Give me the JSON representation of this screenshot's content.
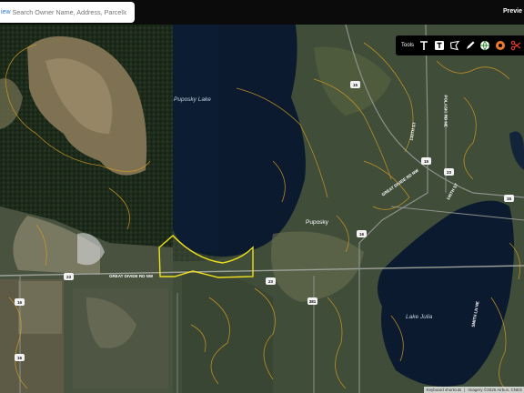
{
  "search": {
    "view_label": "iew",
    "placeholder": "Search Owner Name, Address, ParcelId"
  },
  "header": {
    "preview_label": "Previe"
  },
  "tools": {
    "label": "Tools",
    "items": [
      {
        "icon": "text-tool-icon"
      },
      {
        "icon": "text-box-tool-icon"
      },
      {
        "icon": "polygon-tool-icon"
      },
      {
        "icon": "pencil-tool-icon"
      },
      {
        "icon": "globe-icon"
      },
      {
        "icon": "record-icon"
      },
      {
        "icon": "scissors-icon"
      }
    ]
  },
  "map": {
    "lakes": [
      "Puposky Lake",
      "Lake Julia"
    ],
    "place": "Puposky",
    "route_shields": [
      "15",
      "15",
      "15",
      "23",
      "23",
      "23",
      "16",
      "16",
      "16",
      "381"
    ],
    "road_labels": [
      "GREAT DIVIDE RD NW",
      "GREAT DIVIDE RD NW",
      "POLASKI RD NE",
      "130TH ST",
      "140TH ST",
      "SMITH LN NE"
    ],
    "attribution": {
      "shortcuts": "Keyboard shortcuts",
      "imagery": "Imagery ©2025 Airbus, CNES"
    },
    "colors": {
      "parcel_highlight": "#f0e11c",
      "contours": "#d29a22",
      "water": "#0b1a2e"
    }
  }
}
